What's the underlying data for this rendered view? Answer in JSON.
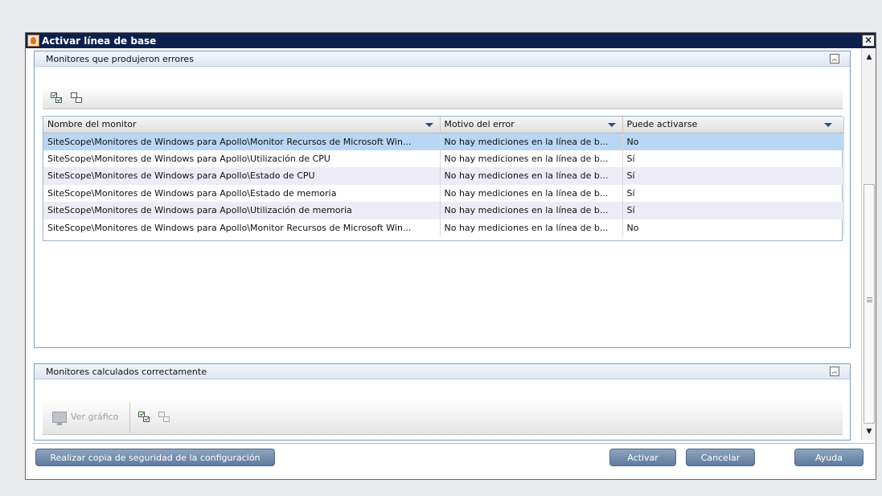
{
  "window": {
    "title": "Activar línea de base",
    "close_glyph": "✕"
  },
  "errors_panel": {
    "title": "Monitores que produjeron errores",
    "collapse_glyph": "︽",
    "toolbar_icons": [
      "select-all-icon",
      "clear-selection-icon"
    ],
    "columns": [
      "Nombre del monitor",
      "Motivo del error",
      "Puede activarse"
    ],
    "rows": [
      [
        "SiteScope\\Monitores de Windows para Apollo\\Monitor Recursos de Microsoft Win...",
        "No hay mediciones en la línea de b...",
        "No"
      ],
      [
        "SiteScope\\Monitores de Windows para Apollo\\Utilización de CPU",
        "No hay mediciones en la línea de b...",
        "Sí"
      ],
      [
        "SiteScope\\Monitores de Windows para Apollo\\Estado de CPU",
        "No hay mediciones en la línea de b...",
        "Sí"
      ],
      [
        "SiteScope\\Monitores de Windows para Apollo\\Estado de memoria",
        "No hay mediciones en la línea de b...",
        "Sí"
      ],
      [
        "SiteScope\\Monitores de Windows para Apollo\\Utilización de memoria",
        "No hay mediciones en la línea de b...",
        "Sí"
      ],
      [
        "SiteScope\\Monitores de Windows para Apollo\\Monitor Recursos de Microsoft Win...",
        "No hay mediciones en la línea de b...",
        "No"
      ]
    ]
  },
  "success_panel": {
    "title": "Monitores calculados correctamente",
    "collapse_glyph": "︽",
    "view_chart_label": "Ver gráfico"
  },
  "footer": {
    "backup_label": "Realizar copia de seguridad de la configuración",
    "activate_label": "Activar",
    "cancel_label": "Cancelar",
    "help_label": "Ayuda"
  },
  "colors": {
    "titlebar": "#0d1f4d",
    "selected_row": "#b8d7f4",
    "alt_row": "#ececf6",
    "button": "#6f89ab"
  }
}
